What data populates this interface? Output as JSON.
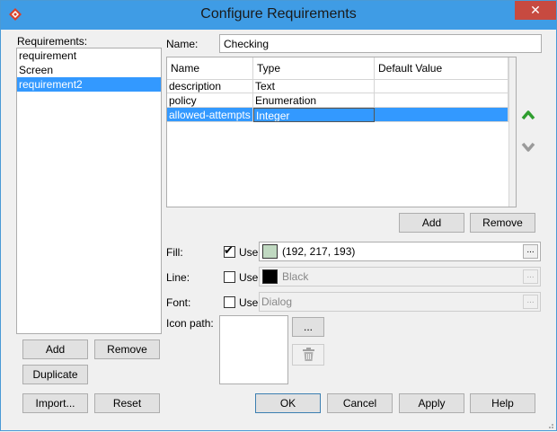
{
  "window": {
    "title": "Configure Requirements"
  },
  "requirements": {
    "label": "Requirements:",
    "items": [
      "requirement",
      "Screen",
      "requirement2"
    ],
    "selected_index": 2,
    "add_label": "Add",
    "remove_label": "Remove",
    "duplicate_label": "Duplicate"
  },
  "name_field": {
    "label": "Name:",
    "value": "Checking"
  },
  "attributes_table": {
    "columns": [
      "Name",
      "Type",
      "Default Value"
    ],
    "rows": [
      {
        "name": "description",
        "type": "Text",
        "default": ""
      },
      {
        "name": "policy",
        "type": "Enumeration",
        "default": ""
      },
      {
        "name": "allowed-attempts",
        "type": "Integer",
        "default": ""
      }
    ],
    "selected_index": 2,
    "add_label": "Add",
    "remove_label": "Remove"
  },
  "fill": {
    "label": "Fill:",
    "use_label": "Use",
    "checked": true,
    "value": "(192, 217, 193)",
    "swatch_color": "#c0d9c1",
    "button_label": "..."
  },
  "line": {
    "label": "Line:",
    "use_label": "Use",
    "checked": false,
    "value": "Black",
    "swatch_color": "#000000",
    "button_label": "..."
  },
  "font": {
    "label": "Font:",
    "use_label": "Use",
    "checked": false,
    "value": "Dialog",
    "button_label": "..."
  },
  "icon_path": {
    "label": "Icon path:",
    "browse_label": "..."
  },
  "footer": {
    "import_label": "Import...",
    "reset_label": "Reset",
    "ok_label": "OK",
    "cancel_label": "Cancel",
    "apply_label": "Apply",
    "help_label": "Help"
  },
  "colors": {
    "titlebar": "#3f9ce5",
    "selection": "#3399ff",
    "close": "#c74a40",
    "move_up": "#2f9e2f",
    "move_down": "#9a9a9a"
  }
}
